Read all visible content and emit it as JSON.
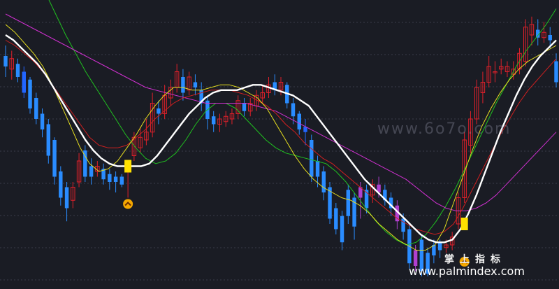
{
  "watermark_top": "www.6o7o.com",
  "watermark_cn": "掌上指标",
  "watermark_url": "www.palmindex.com",
  "chart_data": {
    "type": "candlestick",
    "ylim": [
      0,
      100
    ],
    "grid": true,
    "colors": {
      "background": "#1a1c24",
      "up": "#e0202a",
      "down_ma": "#2266ff",
      "down_main": "#2a8cff",
      "down_alt": "#b040d0",
      "main_line": "#ffffff",
      "ma_yellow": "#e8e020",
      "ma_red": "#d02020",
      "ma_magenta": "#d030d0",
      "ma_green": "#20c020",
      "signal": "#ffe000"
    },
    "candles": [
      {
        "o": 84,
        "c": 80,
        "h": 88,
        "l": 76,
        "up": false
      },
      {
        "o": 79,
        "c": 83,
        "h": 86,
        "l": 75,
        "up": true
      },
      {
        "o": 81,
        "c": 76,
        "h": 83,
        "l": 74,
        "up": false
      },
      {
        "o": 78,
        "c": 70,
        "h": 80,
        "l": 68,
        "up": false
      },
      {
        "o": 75,
        "c": 64,
        "h": 76,
        "l": 62,
        "up": false
      },
      {
        "o": 68,
        "c": 60,
        "h": 70,
        "l": 58,
        "up": false
      },
      {
        "o": 62,
        "c": 56,
        "h": 64,
        "l": 53,
        "up": false
      },
      {
        "o": 58,
        "c": 46,
        "h": 60,
        "l": 43,
        "up": false
      },
      {
        "o": 52,
        "c": 38,
        "h": 53,
        "l": 35,
        "up": false
      },
      {
        "o": 40,
        "c": 30,
        "h": 42,
        "l": 27,
        "up": false
      },
      {
        "o": 34,
        "c": 26,
        "h": 36,
        "l": 21,
        "up": false
      },
      {
        "o": 29,
        "c": 34,
        "h": 36,
        "l": 26,
        "up": true
      },
      {
        "o": 36,
        "c": 44,
        "h": 47,
        "l": 34,
        "up": true
      },
      {
        "o": 48,
        "c": 38,
        "h": 50,
        "l": 36,
        "up": false
      },
      {
        "o": 42,
        "c": 38,
        "h": 45,
        "l": 35,
        "up": false
      },
      {
        "o": 40,
        "c": 42,
        "h": 44,
        "l": 38,
        "up": true
      },
      {
        "o": 41,
        "c": 37,
        "h": 43,
        "l": 35,
        "up": false
      },
      {
        "o": 39,
        "c": 36,
        "h": 41,
        "l": 33,
        "up": false
      },
      {
        "o": 38,
        "c": 36,
        "h": 40,
        "l": 32,
        "up": false
      },
      {
        "o": 38,
        "c": 35,
        "h": 39,
        "l": 34,
        "up": false
      },
      {
        "o": 40,
        "c": 42,
        "h": 44,
        "l": 30,
        "up": true
      },
      {
        "o": 46,
        "c": 53,
        "h": 55,
        "l": 44,
        "up": true
      },
      {
        "o": 49,
        "c": 53,
        "h": 57,
        "l": 47,
        "up": true
      },
      {
        "o": 52,
        "c": 55,
        "h": 60,
        "l": 50,
        "up": true
      },
      {
        "o": 55,
        "c": 66,
        "h": 70,
        "l": 53,
        "up": true
      },
      {
        "o": 64,
        "c": 62,
        "h": 67,
        "l": 58,
        "up": false
      },
      {
        "o": 62,
        "c": 69,
        "h": 73,
        "l": 60,
        "up": true
      },
      {
        "o": 68,
        "c": 72,
        "h": 75,
        "l": 65,
        "up": true
      },
      {
        "o": 72,
        "c": 78,
        "h": 81,
        "l": 70,
        "up": true
      },
      {
        "o": 76,
        "c": 70,
        "h": 79,
        "l": 67,
        "up": false
      },
      {
        "o": 71,
        "c": 76,
        "h": 78,
        "l": 69,
        "up": true
      },
      {
        "o": 74,
        "c": 72,
        "h": 77,
        "l": 69,
        "up": false
      },
      {
        "o": 71,
        "c": 66,
        "h": 74,
        "l": 63,
        "up": false
      },
      {
        "o": 67,
        "c": 60,
        "h": 69,
        "l": 56,
        "up": false
      },
      {
        "o": 61,
        "c": 58,
        "h": 63,
        "l": 55,
        "up": false
      },
      {
        "o": 58,
        "c": 60,
        "h": 62,
        "l": 55,
        "up": true
      },
      {
        "o": 59,
        "c": 61,
        "h": 63,
        "l": 57,
        "up": true
      },
      {
        "o": 60,
        "c": 62,
        "h": 64,
        "l": 58,
        "up": true
      },
      {
        "o": 62,
        "c": 67,
        "h": 69,
        "l": 60,
        "up": true
      },
      {
        "o": 66,
        "c": 63,
        "h": 68,
        "l": 61,
        "up": false
      },
      {
        "o": 63,
        "c": 66,
        "h": 68,
        "l": 61,
        "up": true
      },
      {
        "o": 65,
        "c": 69,
        "h": 71,
        "l": 63,
        "up": true
      },
      {
        "o": 68,
        "c": 70,
        "h": 73,
        "l": 66,
        "up": true
      },
      {
        "o": 70,
        "c": 73,
        "h": 76,
        "l": 68,
        "up": true
      },
      {
        "o": 74,
        "c": 71,
        "h": 77,
        "l": 69,
        "up": false
      },
      {
        "o": 71,
        "c": 74,
        "h": 76,
        "l": 69,
        "up": true
      },
      {
        "o": 73,
        "c": 66,
        "h": 74,
        "l": 64,
        "up": false
      },
      {
        "o": 66,
        "c": 61,
        "h": 68,
        "l": 58,
        "up": false
      },
      {
        "o": 62,
        "c": 56,
        "h": 63,
        "l": 54,
        "up": false
      },
      {
        "o": 57,
        "c": 55,
        "h": 60,
        "l": 50,
        "up": false
      },
      {
        "o": 52,
        "c": 38,
        "h": 54,
        "l": 36,
        "up": false
      },
      {
        "o": 44,
        "c": 38,
        "h": 46,
        "l": 34,
        "up": false
      },
      {
        "o": 40,
        "c": 32,
        "h": 42,
        "l": 29,
        "up": false
      },
      {
        "o": 34,
        "c": 22,
        "h": 36,
        "l": 20,
        "up": false
      },
      {
        "o": 26,
        "c": 18,
        "h": 28,
        "l": 16,
        "up": false
      },
      {
        "o": 23,
        "c": 13,
        "h": 25,
        "l": 10,
        "up": false
      },
      {
        "o": 33,
        "c": 23,
        "h": 35,
        "l": 20,
        "up": false
      },
      {
        "o": 30,
        "c": 19,
        "h": 32,
        "l": 14,
        "up": false
      },
      {
        "o": 34,
        "c": 30,
        "h": 36,
        "l": 22,
        "up": false
      },
      {
        "o": 33,
        "c": 26,
        "h": 35,
        "l": 24,
        "up": false
      },
      {
        "o": 31,
        "c": 35,
        "h": 37,
        "l": 28,
        "up": true
      },
      {
        "o": 35,
        "c": 32,
        "h": 38,
        "l": 30,
        "up": false
      },
      {
        "o": 33,
        "c": 29,
        "h": 35,
        "l": 27,
        "up": false
      },
      {
        "o": 30,
        "c": 26,
        "h": 32,
        "l": 23,
        "up": false
      },
      {
        "o": 27,
        "c": 21,
        "h": 29,
        "l": 18,
        "up": false
      },
      {
        "o": 22,
        "c": 17,
        "h": 24,
        "l": 14,
        "up": false
      },
      {
        "o": 18,
        "c": 5,
        "h": 20,
        "l": 3,
        "up": false
      },
      {
        "o": 10,
        "c": 4,
        "h": 12,
        "l": 2,
        "up": false
      },
      {
        "o": 14,
        "c": 2,
        "h": 16,
        "l": 0,
        "up": false
      },
      {
        "o": 9,
        "c": 1,
        "h": 11,
        "l": 0,
        "up": false
      },
      {
        "o": 12,
        "c": 8,
        "h": 14,
        "l": 5,
        "up": false
      },
      {
        "o": 13,
        "c": 10,
        "h": 14,
        "l": 7,
        "up": false
      },
      {
        "o": 11,
        "c": 12,
        "h": 14,
        "l": 9,
        "up": true
      },
      {
        "o": 12,
        "c": 15,
        "h": 17,
        "l": 10,
        "up": true
      },
      {
        "o": 20,
        "c": 30,
        "h": 32,
        "l": 18,
        "up": true
      },
      {
        "o": 30,
        "c": 52,
        "h": 55,
        "l": 28,
        "up": true
      },
      {
        "o": 50,
        "c": 60,
        "h": 63,
        "l": 47,
        "up": true
      },
      {
        "o": 60,
        "c": 72,
        "h": 75,
        "l": 58,
        "up": true
      },
      {
        "o": 70,
        "c": 74,
        "h": 78,
        "l": 66,
        "up": true
      },
      {
        "o": 74,
        "c": 80,
        "h": 84,
        "l": 72,
        "up": true
      },
      {
        "o": 78,
        "c": 78,
        "h": 82,
        "l": 74,
        "up": true
      },
      {
        "o": 79,
        "c": 80,
        "h": 83,
        "l": 77,
        "up": true
      },
      {
        "o": 78,
        "c": 80,
        "h": 82,
        "l": 76,
        "up": true
      },
      {
        "o": 77,
        "c": 79,
        "h": 82,
        "l": 75,
        "up": true
      },
      {
        "o": 79,
        "c": 85,
        "h": 87,
        "l": 77,
        "up": true
      },
      {
        "o": 82,
        "c": 95,
        "h": 98,
        "l": 80,
        "up": true
      },
      {
        "o": 92,
        "c": 96,
        "h": 99,
        "l": 88,
        "up": true
      },
      {
        "o": 94,
        "c": 91,
        "h": 98,
        "l": 88,
        "up": false
      },
      {
        "o": 91,
        "c": 93,
        "h": 97,
        "l": 89,
        "up": true
      },
      {
        "o": 92,
        "c": 90,
        "h": 95,
        "l": 87,
        "up": false
      },
      {
        "o": 82,
        "c": 74,
        "h": 85,
        "l": 72,
        "up": false
      }
    ],
    "lines": {
      "white": [
        92,
        90,
        87,
        84,
        81,
        77,
        72,
        67,
        62,
        57,
        52,
        48,
        45,
        43,
        42,
        42,
        42,
        42,
        43,
        46,
        50,
        54,
        58,
        62,
        65,
        68,
        70,
        71,
        71,
        71,
        72,
        73,
        73,
        72,
        71,
        70,
        69,
        67,
        65,
        61,
        57,
        53,
        49,
        45,
        41,
        37,
        34,
        31,
        28,
        25,
        22,
        19,
        16,
        14,
        13,
        13,
        14,
        18,
        24,
        31,
        39,
        47,
        55,
        62,
        69,
        75,
        80,
        84,
        87,
        90
      ],
      "yellow": [
        96,
        93,
        89,
        85,
        80,
        73,
        65,
        57,
        49,
        43,
        40,
        41,
        44,
        49,
        54,
        60,
        65,
        69,
        72,
        72,
        71,
        71,
        72,
        73,
        73,
        72,
        70,
        68,
        64,
        58,
        52,
        46,
        41,
        37,
        34,
        32,
        30,
        29,
        27,
        24,
        20,
        17,
        14,
        12,
        10,
        10,
        12,
        18,
        28,
        38,
        48,
        57,
        64,
        70,
        75,
        79,
        82,
        84,
        86,
        88
      ],
      "red": [
        90,
        88,
        85,
        82,
        78,
        73,
        68,
        63,
        58,
        53,
        50,
        49,
        49,
        50,
        53,
        56,
        60,
        63,
        66,
        68,
        69,
        70,
        71,
        71,
        71,
        70,
        69,
        67,
        65,
        62,
        58,
        55,
        51,
        48,
        45,
        43,
        40,
        37,
        34,
        31,
        28,
        25,
        22,
        20,
        18,
        17,
        16,
        17,
        20,
        26,
        33,
        40,
        47,
        54,
        60,
        66,
        71,
        75,
        79,
        83
      ],
      "magenta": [
        100,
        98,
        96,
        94,
        92,
        90,
        88,
        86,
        84,
        82,
        80,
        78,
        76,
        74,
        72,
        71,
        70,
        69,
        68,
        67,
        66,
        66,
        66,
        66,
        66,
        65,
        64,
        63,
        61,
        59,
        57,
        55,
        53,
        51,
        49,
        47,
        45,
        43,
        41,
        39,
        37,
        34,
        31,
        28,
        26,
        25,
        25,
        26,
        28,
        31,
        35,
        39,
        43,
        47,
        51,
        55
      ],
      "green": [
        110,
        113,
        114,
        113,
        108,
        100,
        92,
        85,
        78,
        72,
        66,
        60,
        54,
        49,
        45,
        43,
        44,
        47,
        52,
        58,
        63,
        66,
        66,
        64,
        60,
        56,
        52,
        49,
        47,
        46,
        45,
        44,
        43,
        40,
        36,
        31,
        26,
        21,
        17,
        14,
        12,
        13,
        16,
        21,
        27,
        34,
        42,
        50,
        58,
        66,
        73,
        80,
        86,
        91,
        96,
        102
      ]
    },
    "signals": [
      {
        "candle": 20,
        "y": 42,
        "arrow": "up"
      },
      {
        "candle": 75,
        "y": 20,
        "arrow": "up"
      }
    ]
  }
}
